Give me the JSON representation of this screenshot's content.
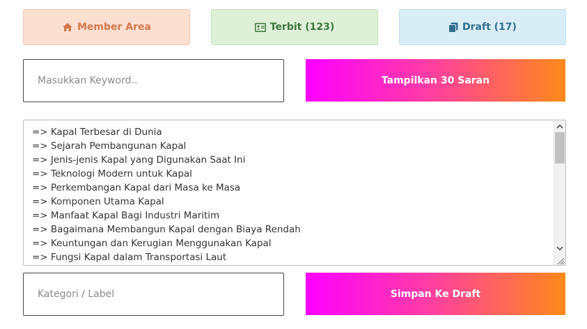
{
  "top_buttons": {
    "member": {
      "label": "Member Area",
      "icon": "home-icon",
      "color": "#d4784b"
    },
    "terbit": {
      "label": "Terbit (123)",
      "icon": "id-card-icon",
      "color": "#3c763d"
    },
    "draft": {
      "label": "Draft (17)",
      "icon": "copy-icon",
      "color": "#31708f"
    }
  },
  "keyword": {
    "placeholder": "Masukkan Keyword..",
    "value": ""
  },
  "show_button": {
    "label": "Tampilkan 30 Saran"
  },
  "suggestions": [
    "=> Kapal Terbesar di Dunia",
    "=> Sejarah Pembangunan Kapal",
    "=> Jenis-jenis Kapal yang Digunakan Saat Ini",
    "=> Teknologi Modern untuk Kapal",
    "=> Perkembangan Kapal dari Masa ke Masa",
    "=> Komponen Utama Kapal",
    "=> Manfaat Kapal Bagi Industri Maritim",
    "=> Bagaimana Membangun Kapal dengan Biaya Rendah",
    "=> Keuntungan dan Kerugian Menggunakan Kapal",
    "=> Fungsi Kapal dalam Transportasi Laut"
  ],
  "category": {
    "placeholder": "Kategori / Label",
    "value": ""
  },
  "save_button": {
    "label": "Simpan Ke Draft"
  },
  "colors": {
    "gradient_start": "#ff00ff",
    "gradient_end": "#ff8a1a"
  }
}
